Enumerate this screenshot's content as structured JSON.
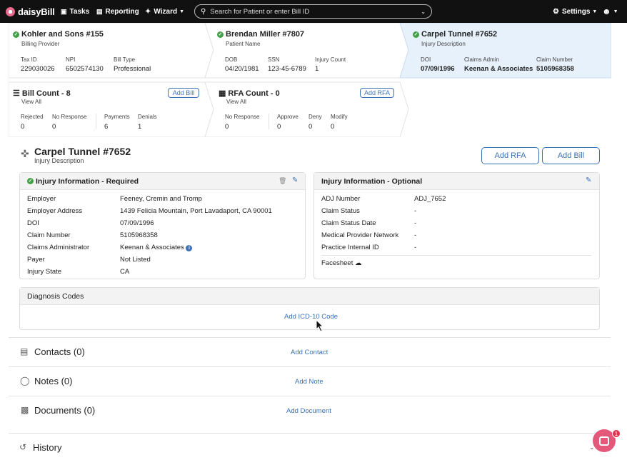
{
  "nav": {
    "logo": "daisyBill",
    "tasks": "Tasks",
    "reporting": "Reporting",
    "wizard": "Wizard",
    "search_placeholder": "Search for Patient or enter Bill ID",
    "settings": "Settings"
  },
  "cards": {
    "provider": {
      "title": "Kohler and Sons #155",
      "subtitle": "Billing Provider",
      "fields": [
        {
          "label": "Tax ID",
          "value": "229030026"
        },
        {
          "label": "NPI",
          "value": "6502574130"
        },
        {
          "label": "Bill Type",
          "value": "Professional"
        }
      ]
    },
    "patient": {
      "title": "Brendan Miller #7807",
      "subtitle": "Patient Name",
      "fields": [
        {
          "label": "DOB",
          "value": "04/20/1981"
        },
        {
          "label": "SSN",
          "value": "123-45-6789"
        },
        {
          "label": "Injury Count",
          "value": "1"
        }
      ]
    },
    "injury": {
      "title": "Carpel Tunnel #7652",
      "subtitle": "Injury Description",
      "fields": [
        {
          "label": "DOI",
          "value": "07/09/1996"
        },
        {
          "label": "Claims Admin",
          "value": "Keenan & Associates"
        },
        {
          "label": "Claim Number",
          "value": "5105968358"
        }
      ]
    },
    "bills": {
      "title": "Bill Count - 8",
      "view_all": "View All",
      "add": "Add Bill",
      "fields": [
        {
          "label": "Rejected",
          "value": "0"
        },
        {
          "label": "No Response",
          "value": "0"
        },
        {
          "label": "Payments",
          "value": "6"
        },
        {
          "label": "Denials",
          "value": "1"
        }
      ]
    },
    "rfa": {
      "title": "RFA Count - 0",
      "view_all": "View All",
      "add": "Add RFA",
      "fields": [
        {
          "label": "No Response",
          "value": "0"
        },
        {
          "label": "Approve",
          "value": "0"
        },
        {
          "label": "Deny",
          "value": "0"
        },
        {
          "label": "Modify",
          "value": "0"
        }
      ]
    }
  },
  "page": {
    "title": "Carpel Tunnel #7652",
    "subtitle": "Injury Description",
    "add_rfa": "Add RFA",
    "add_bill": "Add Bill"
  },
  "required": {
    "title": "Injury Information - Required",
    "rows": [
      {
        "label": "Employer",
        "value": "Feeney, Cremin and Tromp"
      },
      {
        "label": "Employer Address",
        "value": "1439 Felicia Mountain, Port Lavadaport, CA 90001"
      },
      {
        "label": "DOI",
        "value": "07/09/1996"
      },
      {
        "label": "Claim Number",
        "value": "5105968358"
      },
      {
        "label": "Claims Administrator",
        "value": "Keenan & Associates"
      },
      {
        "label": "Payer",
        "value": "Not Listed"
      },
      {
        "label": "Injury State",
        "value": "CA"
      }
    ]
  },
  "optional": {
    "title": "Injury Information - Optional",
    "rows": [
      {
        "label": "ADJ Number",
        "value": "ADJ_7652"
      },
      {
        "label": "Claim Status",
        "value": "-"
      },
      {
        "label": "Claim Status Date",
        "value": "-"
      },
      {
        "label": "Medical Provider Network",
        "value": "-"
      },
      {
        "label": "Practice Internal ID",
        "value": "-"
      }
    ],
    "facesheet": "Facesheet"
  },
  "diagnosis": {
    "title": "Diagnosis Codes",
    "add": "Add ICD-10 Code"
  },
  "sections": {
    "contacts": {
      "title": "Contacts (0)",
      "add": "Add Contact"
    },
    "notes": {
      "title": "Notes (0)",
      "add": "Add Note"
    },
    "documents": {
      "title": "Documents (0)",
      "add": "Add Document"
    },
    "history": {
      "title": "History"
    }
  },
  "chat_badge": "1"
}
